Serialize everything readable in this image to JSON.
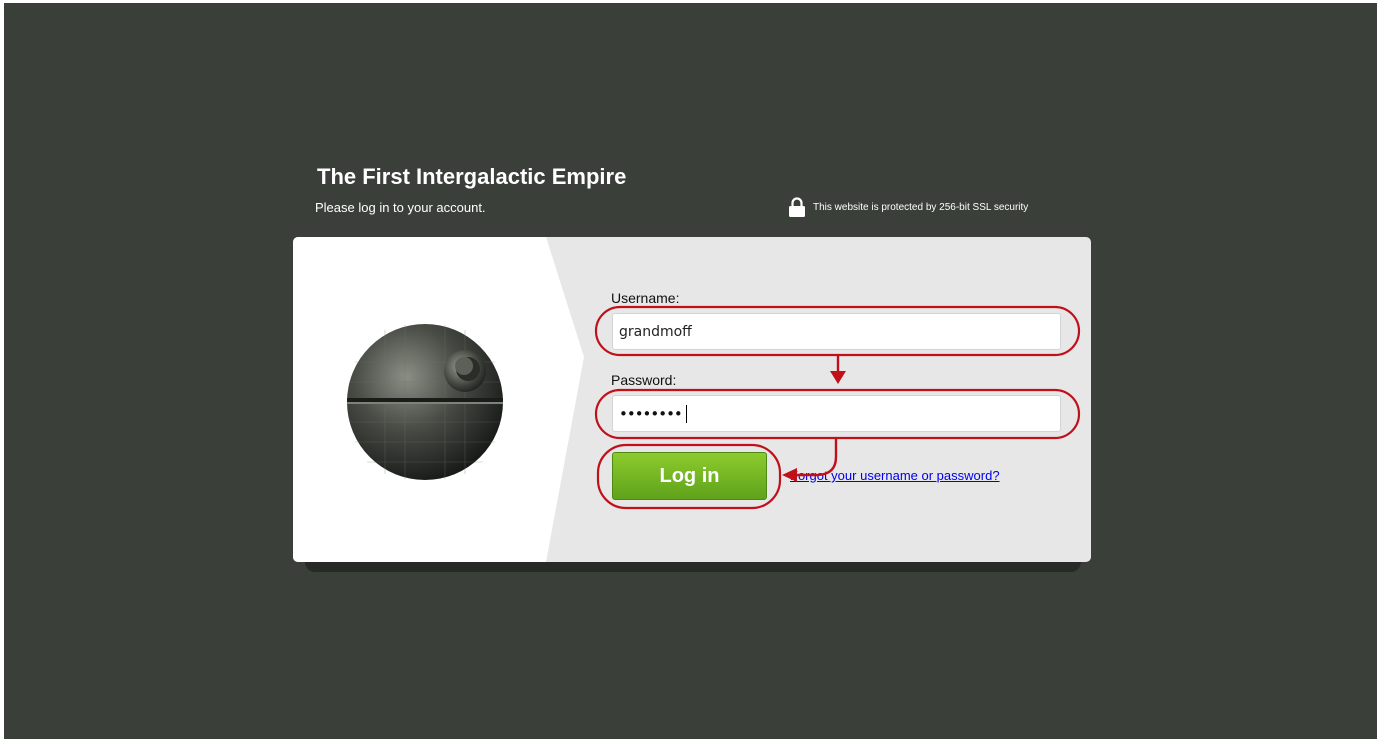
{
  "header": {
    "title": "The First Intergalactic Empire",
    "subtitle": "Please log in to your account.",
    "ssl_notice": "This website is protected by 256-bit SSL security",
    "ssl_icon": "lock-icon"
  },
  "form": {
    "username_label": "Username:",
    "username_value": "grandmoff",
    "password_label": "Password:",
    "password_masked": "••••••••",
    "login_label": "Log in",
    "forgot_link": "Forgot your username or password?"
  },
  "illustration": "death-star-image",
  "colors": {
    "background": "#3b3f3a",
    "button": "#6fb21f",
    "link": "#0000ee",
    "annotation": "#c0101a"
  }
}
